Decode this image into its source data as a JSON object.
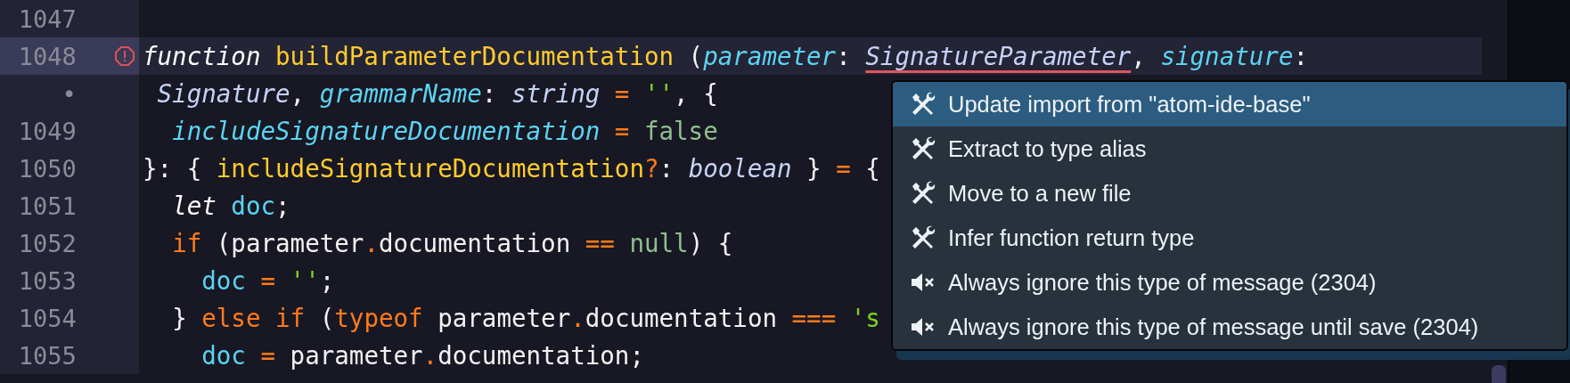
{
  "editor": {
    "lines": [
      {
        "number": "1047",
        "current": false,
        "error": false
      },
      {
        "number": "1048",
        "current": true,
        "error": true,
        "tokens": [
          {
            "kind": "storage",
            "text": "function "
          },
          {
            "kind": "fn",
            "text": "buildParameterDocumentation"
          },
          {
            "kind": "plain",
            "text": " ("
          },
          {
            "kind": "param",
            "text": "parameter"
          },
          {
            "kind": "plain",
            "text": ": "
          },
          {
            "kind": "type_error",
            "text": "SignatureParameter"
          },
          {
            "kind": "plain",
            "text": ", "
          },
          {
            "kind": "param",
            "text": "signature"
          },
          {
            "kind": "plain",
            "text": ":"
          }
        ]
      },
      {
        "number": "•",
        "current": false,
        "error": false,
        "tokens": [
          {
            "kind": "type",
            "text": " Signature"
          },
          {
            "kind": "plain",
            "text": ", "
          },
          {
            "kind": "param",
            "text": "grammarName"
          },
          {
            "kind": "plain",
            "text": ": "
          },
          {
            "kind": "type",
            "text": "string "
          },
          {
            "kind": "op",
            "text": "= "
          },
          {
            "kind": "str",
            "text": "''"
          },
          {
            "kind": "plain",
            "text": ", {"
          }
        ]
      },
      {
        "number": "1049",
        "current": false,
        "error": false,
        "tokens": [
          {
            "kind": "param",
            "text": "  includeSignatureDocumentation "
          },
          {
            "kind": "op",
            "text": "= "
          },
          {
            "kind": "lit",
            "text": "false"
          }
        ]
      },
      {
        "number": "1050",
        "current": false,
        "error": false,
        "tokens": [
          {
            "kind": "plain",
            "text": "}: { "
          },
          {
            "kind": "fn",
            "text": "includeSignatureDocumentation"
          },
          {
            "kind": "op",
            "text": "?"
          },
          {
            "kind": "plain",
            "text": ": "
          },
          {
            "kind": "type",
            "text": "boolean"
          },
          {
            "kind": "plain",
            "text": " } "
          },
          {
            "kind": "op",
            "text": "="
          },
          {
            "kind": "plain",
            "text": " {"
          }
        ]
      },
      {
        "number": "1051",
        "current": false,
        "error": false,
        "tokens": [
          {
            "kind": "storage",
            "text": "  let "
          },
          {
            "kind": "var",
            "text": "doc"
          },
          {
            "kind": "plain",
            "text": ";"
          }
        ]
      },
      {
        "number": "1052",
        "current": false,
        "error": false,
        "tokens": [
          {
            "kind": "kw",
            "text": "  if"
          },
          {
            "kind": "plain",
            "text": " (parameter"
          },
          {
            "kind": "op",
            "text": "."
          },
          {
            "kind": "plain",
            "text": "documentation "
          },
          {
            "kind": "op",
            "text": "== "
          },
          {
            "kind": "lit",
            "text": "null"
          },
          {
            "kind": "plain",
            "text": ") {"
          }
        ]
      },
      {
        "number": "1053",
        "current": false,
        "error": false,
        "tokens": [
          {
            "kind": "var",
            "text": "    doc "
          },
          {
            "kind": "op",
            "text": "= "
          },
          {
            "kind": "str",
            "text": "''"
          },
          {
            "kind": "plain",
            "text": ";"
          }
        ]
      },
      {
        "number": "1054",
        "current": false,
        "error": false,
        "tokens": [
          {
            "kind": "plain",
            "text": "  } "
          },
          {
            "kind": "kw",
            "text": "else if"
          },
          {
            "kind": "plain",
            "text": " ("
          },
          {
            "kind": "kw",
            "text": "typeof"
          },
          {
            "kind": "plain",
            "text": " parameter"
          },
          {
            "kind": "op",
            "text": "."
          },
          {
            "kind": "plain",
            "text": "documentation "
          },
          {
            "kind": "op",
            "text": "=== "
          },
          {
            "kind": "str",
            "text": "'s"
          }
        ]
      },
      {
        "number": "1055",
        "current": false,
        "error": false,
        "tokens": [
          {
            "kind": "var",
            "text": "    doc "
          },
          {
            "kind": "op",
            "text": "="
          },
          {
            "kind": "plain",
            "text": " parameter"
          },
          {
            "kind": "op",
            "text": "."
          },
          {
            "kind": "plain",
            "text": "documentation;"
          }
        ]
      }
    ]
  },
  "code_actions": [
    {
      "kind": "fix",
      "label": "Update import from \"atom-ide-base\"",
      "selected": true
    },
    {
      "kind": "fix",
      "label": "Extract to type alias",
      "selected": false
    },
    {
      "kind": "fix",
      "label": "Move to a new file",
      "selected": false
    },
    {
      "kind": "fix",
      "label": "Infer function return type",
      "selected": false
    },
    {
      "kind": "ignore",
      "label": "Always ignore this type of message (2304)",
      "selected": false
    },
    {
      "kind": "ignore",
      "label": "Always ignore this type of message until save (2304)",
      "selected": false
    }
  ]
}
